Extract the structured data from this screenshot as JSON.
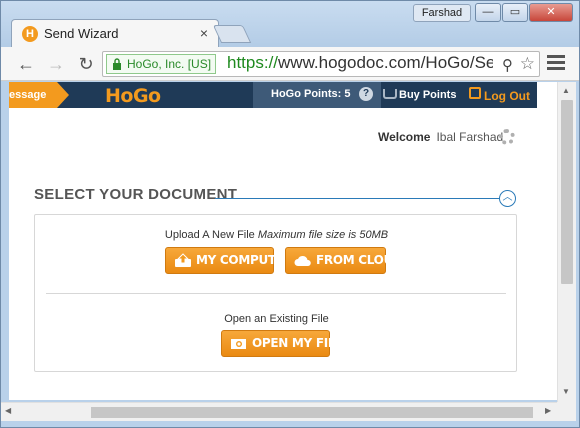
{
  "window": {
    "user_chip": "Farshad",
    "minimize_glyph": "—",
    "maximize_glyph": "▭",
    "close_glyph": "✕"
  },
  "tab": {
    "favicon": "H",
    "title": "Send Wizard",
    "close_glyph": "×"
  },
  "toolbar": {
    "back_glyph": "←",
    "forward_glyph": "→",
    "reload_glyph": "↻",
    "ev_badge": "HoGo, Inc. [US]",
    "url_scheme": "https://",
    "url_rest": "www.hogodoc.com/HoGo/Send",
    "search_glyph": "⚲",
    "star_glyph": "☆"
  },
  "app_header": {
    "tab_label": "essage",
    "logo": "HoGo",
    "points_label": "HoGo Points: 5",
    "help_glyph": "?",
    "buy_points": "Buy Points",
    "logout": "Log Out",
    "colors": {
      "bar": "#1f3a57",
      "accent": "#f39a1e"
    }
  },
  "welcome": {
    "label": "Welcome",
    "name": "Ibal Farshad"
  },
  "section": {
    "title": "SELECT YOUR DOCUMENT",
    "collapse_glyph": "︿"
  },
  "upload": {
    "label": "Upload A New File",
    "sub": "Maximum file size is 50MB",
    "btn_computer": "MY COMPUTER",
    "btn_cloud": "FROM CLOUD"
  },
  "existing": {
    "label": "Open an Existing File",
    "btn_open": "OPEN MY FILE"
  },
  "scroll": {
    "up": "▲",
    "down": "▼",
    "left": "◀",
    "right": "▶"
  }
}
